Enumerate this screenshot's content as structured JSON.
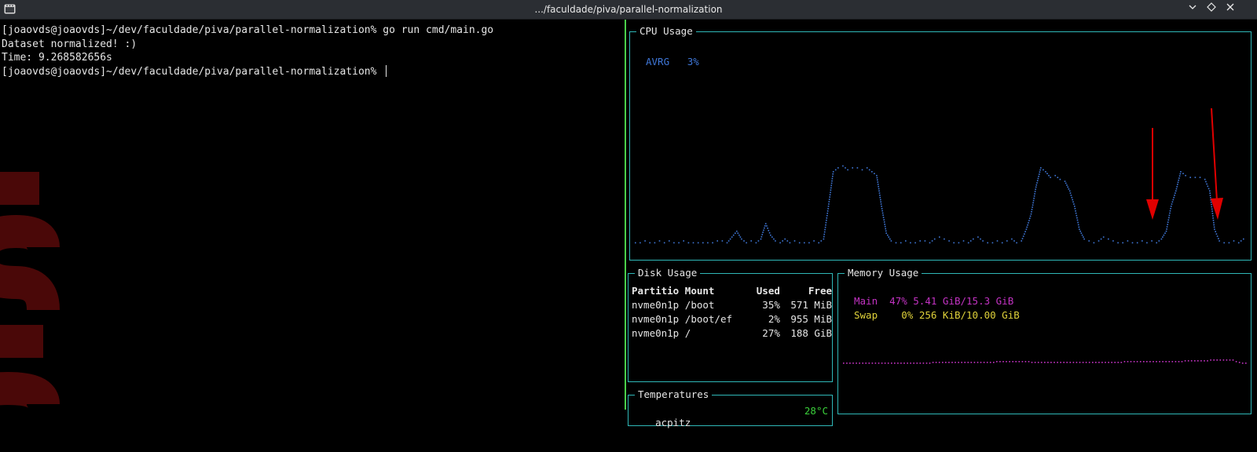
{
  "window": {
    "title": ".../faculdade/piva/parallel-normalization"
  },
  "terminal": {
    "lines": [
      "[joaovds@joaovds]~/dev/faculdade/piva/parallel-normalization% go run cmd/main.go",
      "Dataset normalized! :)",
      "Time: 9.268582656s",
      "[joaovds@joaovds]~/dev/faculdade/piva/parallel-normalization% "
    ]
  },
  "cpu": {
    "title": "CPU Usage",
    "avrg_label": "AVRG",
    "avrg_value": "3%",
    "series_color": "#3f77d8",
    "history": [
      3,
      3,
      4,
      3,
      3,
      4,
      3,
      4,
      3,
      3,
      4,
      3,
      3,
      3,
      3,
      3,
      3,
      4,
      4,
      3,
      6,
      9,
      5,
      3,
      4,
      3,
      5,
      13,
      7,
      4,
      3,
      5,
      3,
      4,
      3,
      3,
      3,
      4,
      3,
      5,
      22,
      40,
      42,
      43,
      41,
      42,
      42,
      41,
      42,
      40,
      38,
      22,
      8,
      4,
      3,
      3,
      4,
      3,
      3,
      4,
      4,
      3,
      5,
      6,
      5,
      4,
      3,
      3,
      4,
      3,
      5,
      6,
      4,
      3,
      3,
      4,
      3,
      4,
      5,
      3,
      4,
      10,
      18,
      32,
      42,
      40,
      37,
      38,
      36,
      35,
      30,
      22,
      10,
      5,
      4,
      3,
      4,
      6,
      5,
      4,
      3,
      3,
      4,
      3,
      3,
      4,
      3,
      4,
      3,
      5,
      9,
      22,
      30,
      40,
      38,
      37,
      37,
      37,
      36,
      30,
      10,
      4,
      3,
      3,
      4,
      3,
      5
    ]
  },
  "disk": {
    "title": "Disk Usage",
    "headers": [
      "Partitio",
      "Mount",
      "Used",
      "Free"
    ],
    "rows": [
      [
        "nvme0n1p",
        "/boot",
        "35%",
        "571 MiB"
      ],
      [
        "nvme0n1p",
        "/boot/ef",
        "2%",
        "955 MiB"
      ],
      [
        "nvme0n1p",
        "/",
        "27%",
        "188 GiB"
      ]
    ]
  },
  "memory": {
    "title": "Memory Usage",
    "main": {
      "label": "Main",
      "percent": "47%",
      "detail": "5.41 GiB/15.3 GiB",
      "color": "#c433c4"
    },
    "swap": {
      "label": "Swap",
      "percent": "0%",
      "detail": "256 KiB/10.00 GiB",
      "color": "#e0d23a"
    },
    "history": [
      47,
      47,
      47,
      47,
      47,
      47,
      47,
      47,
      47,
      47,
      47,
      47,
      47,
      47,
      47,
      47,
      47,
      47,
      47,
      47,
      47,
      47,
      47,
      47,
      47,
      47,
      47,
      47,
      48,
      48,
      48,
      48,
      48,
      48,
      48,
      48,
      48,
      48,
      48,
      48,
      48,
      48,
      48,
      48,
      48,
      48,
      48,
      48,
      49,
      49,
      49,
      49,
      49,
      49,
      49,
      49,
      49,
      49,
      49,
      48,
      48,
      48,
      48,
      48,
      48,
      48,
      48,
      48,
      48,
      48,
      48,
      48,
      48,
      48,
      48,
      48,
      48,
      48,
      48,
      48,
      48,
      48,
      48,
      48,
      48,
      48,
      48,
      48,
      49,
      49,
      49,
      49,
      49,
      49,
      49,
      49,
      49,
      49,
      49,
      49,
      49,
      49,
      49,
      49,
      49,
      49,
      49,
      50,
      50,
      50,
      50,
      50,
      50,
      50,
      50,
      51,
      51,
      51,
      51,
      51,
      51,
      51,
      51,
      49,
      48,
      47,
      47
    ]
  },
  "temperatures": {
    "title": "Temperatures",
    "rows": [
      {
        "name": "acpitz",
        "value": "28°C"
      }
    ]
  },
  "annotations": {
    "arrow_color": "#e00000"
  }
}
